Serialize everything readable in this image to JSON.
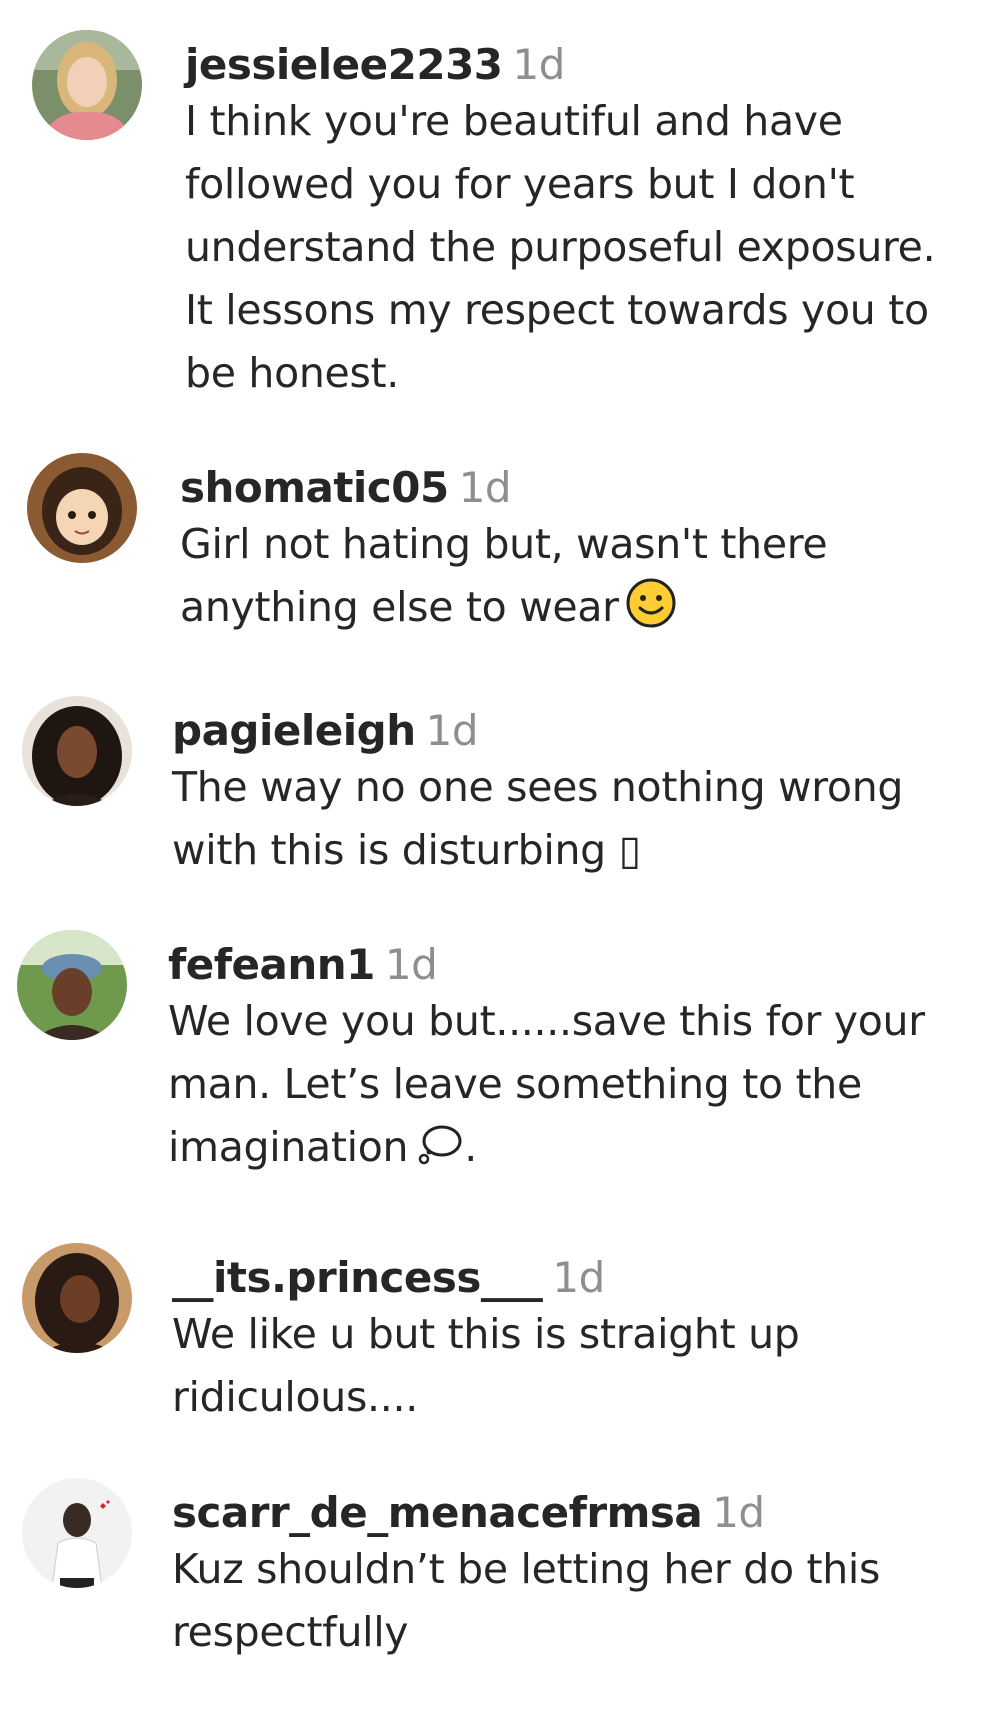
{
  "comments": [
    {
      "username": "jessielee2233",
      "time": "1d",
      "text": "I think you're beautiful and have\nfollowed you for years but I don't\nunderstand the purposeful exposure.\nIt lessons my respect towards you to\nbe honest.",
      "avatar": "avatar-photo-blonde-woman"
    },
    {
      "username": "shomatic05",
      "time": "1d",
      "text": "Girl not hating but, wasn't there\nanything else to wear",
      "emoji": "slightly-smiling-face-emoji",
      "avatar": "avatar-anime-girl"
    },
    {
      "username": "pagieleigh",
      "time": "1d",
      "text": "The way no one sees nothing wrong\nwith this is disturbing ▯",
      "avatar": "avatar-photo-curly-hair-woman"
    },
    {
      "username": "fefeann1",
      "time": "1d",
      "text": "We love you but......save this for your\nman. Let’s leave something to the\nimagination",
      "emoji": "thought-bubble-emoji",
      "trailing": ".",
      "avatar": "avatar-photo-woman-cap"
    },
    {
      "username": "__its.princess___",
      "time": "1d",
      "text": "We like u but this is straight up\nridiculous....",
      "avatar": "avatar-photo-braids-woman"
    },
    {
      "username": "scarr_de_menacefrmsa",
      "time": "1d",
      "text": "Kuz shouldn’t be letting her do this\nrespectfully",
      "avatar": "avatar-photo-man-white-shirt"
    }
  ],
  "colors": {
    "text": "#262626",
    "muted": "#8e8e8e",
    "emoji_yellow": "#ffcc33"
  }
}
